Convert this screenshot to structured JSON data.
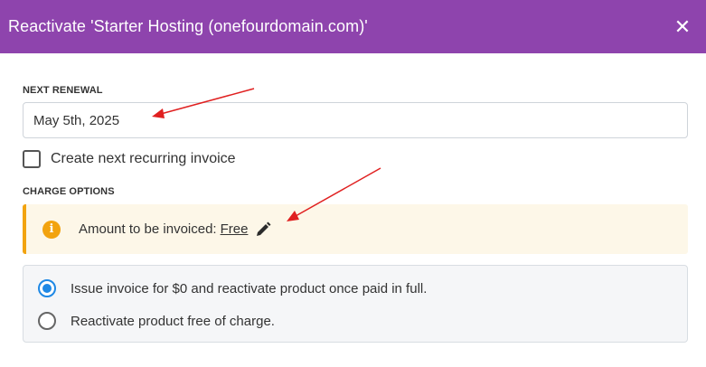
{
  "modal": {
    "title": "Reactivate 'Starter Hosting (onefourdomain.com)'",
    "close_icon": "close-icon",
    "header_color": "#8e44ad"
  },
  "next_renewal": {
    "label": "NEXT RENEWAL",
    "value": "May 5th, 2025"
  },
  "recurring_invoice": {
    "label": "Create next recurring invoice",
    "checked": false
  },
  "charge_options": {
    "label": "CHARGE OPTIONS",
    "alert_text": "Amount to be invoiced:",
    "amount_link": "Free",
    "alert_icon": "info-icon",
    "edit_icon": "pencil-icon",
    "alert_color": "#f2a30f",
    "options": [
      {
        "label": "Issue invoice for $0 and reactivate product once paid in full.",
        "selected": true
      },
      {
        "label": "Reactivate product free of charge.",
        "selected": false
      }
    ]
  },
  "accent_color": "#1e88e5",
  "annotation_color": "#e02020"
}
